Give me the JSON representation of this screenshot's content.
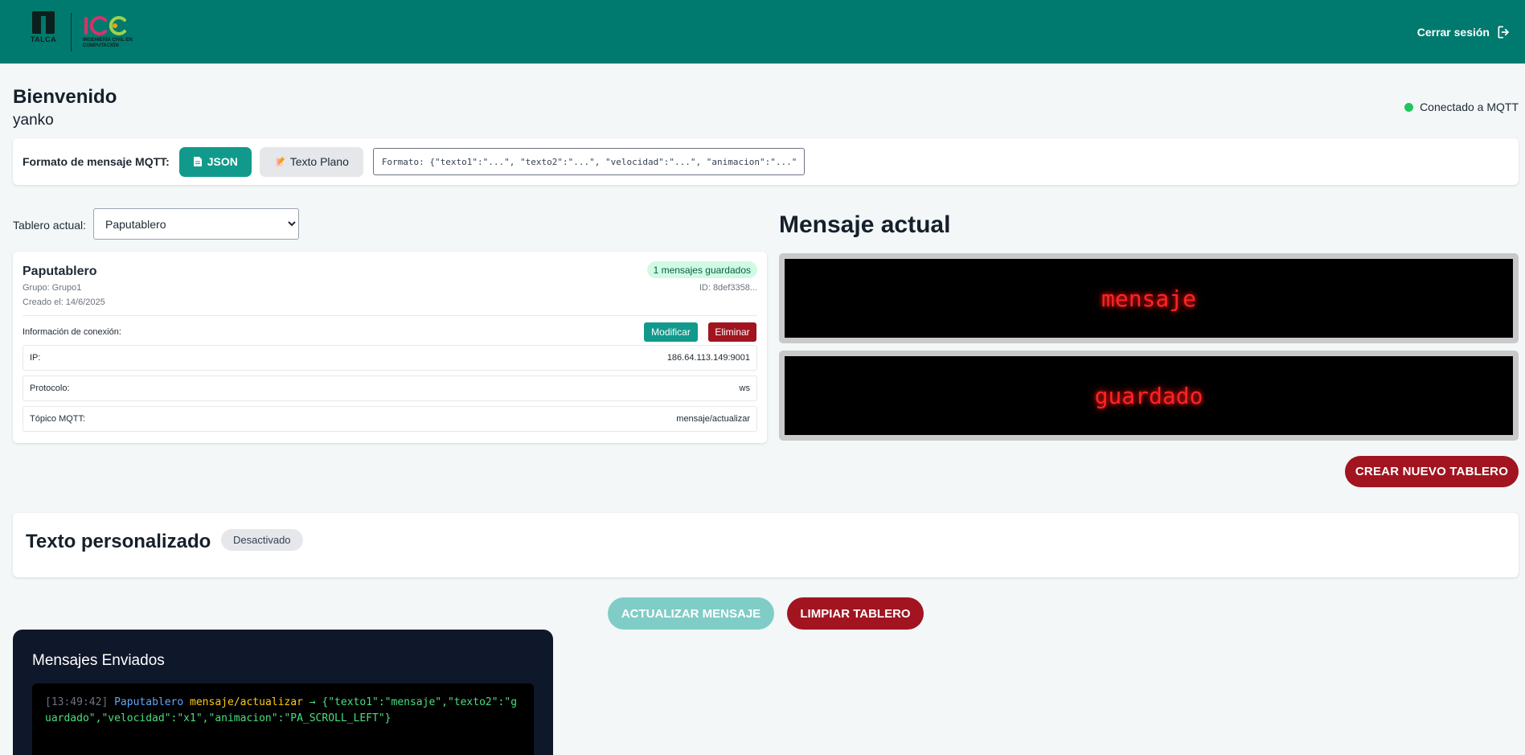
{
  "header": {
    "logo_talca_text": "TALCA",
    "logo_icc_text": "INGENIERÍA CIVIL EN COMPUTACIÓN",
    "logout_label": "Cerrar sesión",
    "bg_color": "#007a6e"
  },
  "welcome": {
    "title": "Bienvenido",
    "user": "yanko"
  },
  "status": {
    "label": "Conectado a MQTT",
    "color": "#22c55e"
  },
  "format": {
    "label": "Formato de mensaje MQTT:",
    "json_label": "JSON",
    "plain_label": "Texto Plano",
    "input_value": "Formato: {\"texto1\":\"...\", \"texto2\":\"...\", \"velocidad\":\"...\", \"animacion\":\"...\"}"
  },
  "selector": {
    "label": "Tablero actual:",
    "selected": "Paputablero"
  },
  "board": {
    "name": "Paputablero",
    "group": "Grupo: Grupo1",
    "created": "Creado el: 14/6/2025",
    "saved_badge": "1 mensajes guardados",
    "id": "ID: 8def3358...",
    "connection_label": "Información de conexión:",
    "modify_label": "Modificar",
    "delete_label": "Eliminar",
    "rows": [
      {
        "label": "IP:",
        "value": "186.64.113.149:9001"
      },
      {
        "label": "Protocolo:",
        "value": "ws"
      },
      {
        "label": "Tópico MQTT:",
        "value": "mensaje/actualizar"
      }
    ]
  },
  "message": {
    "title": "Mensaje actual",
    "line1": "mensaje",
    "line2": "guardado",
    "led_color": "#ff2424",
    "create_label": "CREAR NUEVO TABLERO"
  },
  "custom": {
    "title": "Texto personalizado",
    "badge": "Desactivado"
  },
  "actions": {
    "update_label": "ACTUALIZAR MENSAJE",
    "clear_label": "LIMPIAR TABLERO"
  },
  "log": {
    "title": "Mensajes Enviados",
    "entries": [
      {
        "time": "[13:49:42]",
        "board": "Paputablero",
        "topic": "mensaje/actualizar",
        "arrow": "→",
        "payload": "{\"texto1\":\"mensaje\",\"texto2\":\"guardado\",\"velocidad\":\"x1\",\"animacion\":\"PA_SCROLL_LEFT\"}"
      }
    ]
  }
}
